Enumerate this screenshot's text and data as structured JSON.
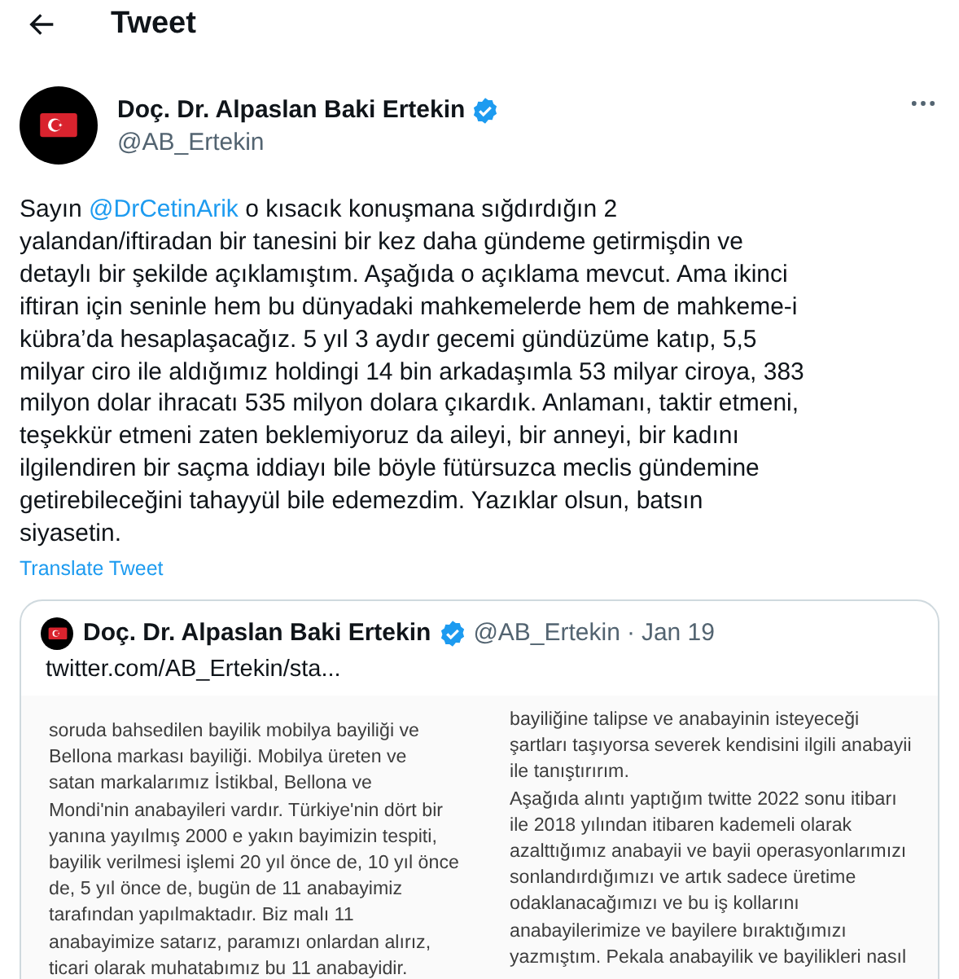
{
  "header": {
    "title": "Tweet"
  },
  "author": {
    "name": "Doç. Dr. Alpaslan Baki Ertekin",
    "handle": "@AB_Ertekin",
    "verified": true
  },
  "body": {
    "lead": "Sayın",
    "mention": "@DrCetinArik",
    "first_rest": "o kısacık konuşmana sığdırdığın 2",
    "lines": [
      "yalandan/iftiradan bir tanesini bir kez daha gündeme getirmişdin ve",
      "detaylı bir şekilde açıklamıştım. Aşağıda o açıklama mevcut. Ama ikinci",
      "iftiran için seninle hem bu dünyadaki mahkemelerde hem de mahkeme-i",
      "kübra’da hesaplaşacağız. 5 yıl 3 aydır gecemi gündüzüme katıp, 5,5",
      "milyar ciro ile aldığımız holdingi 14 bin arkadaşımla 53 milyar ciroya, 383",
      "milyon dolar ihracatı 535 milyon dolara çıkardık. Anlamanı, taktir etmeni,",
      "teşekkür etmeni zaten beklemiyoruz da aileyi, bir anneyi, bir kadını",
      "ilgilendiren bir saçma iddiayı bile böyle fütürsuzca meclis gündemine",
      "getirebileceğini tahayyül bile edemezdim. Yazıklar olsun, batsın",
      "siyasetin."
    ]
  },
  "translate_link": "Translate Tweet",
  "quote": {
    "name": "Doç. Dr. Alpaslan Baki Ertekin",
    "verified": true,
    "handle": "@AB_Ertekin",
    "separator": "·",
    "date": "Jan 19",
    "link": "twitter.com/AB_Ertekin/sta...",
    "document": {
      "left_column": [
        "soruda bahsedilen bayilik mobilya bayiliği ve",
        "Bellona markası bayiliği. Mobilya üreten ve",
        "satan markalarımız İstikbal, Bellona ve",
        "Mondi'nin anabayileri vardır. Türkiye'nin dört bir",
        "yanına yayılmış 2000 e yakın bayimizin tespiti,",
        "bayilik verilmesi işlemi 20 yıl önce de, 10 yıl önce",
        "de, 5 yıl önce de, bugün de 11 anabayimiz",
        "tarafından yapılmaktadır. Biz malı 11",
        "anabayimize satarız, paramızı onlardan alırız,",
        "ticari olarak muhatabımız bu 11 anabayidir."
      ],
      "right_column": [
        "bayiliğine talipse ve anabayinin isteyeceği",
        "şartları taşıyorsa severek kendisini ilgili anabayii",
        "ile tanıştırırım.",
        "Aşağıda alıntı yaptığım twitte 2022 sonu itibarı",
        "ile 2018 yılından itibaren kademeli olarak",
        "azalttığımız anabayii ve bayii operasyonlarımızı",
        "sonlandırdığımızı ve artık sadece üretime",
        "odaklanacağımızı ve bu iş kollarını",
        "anabayilerimize ve bayilere bıraktığımızı",
        "yazmıştım. Pekala anabayilik ve bayilikleri nasıl"
      ]
    }
  }
}
